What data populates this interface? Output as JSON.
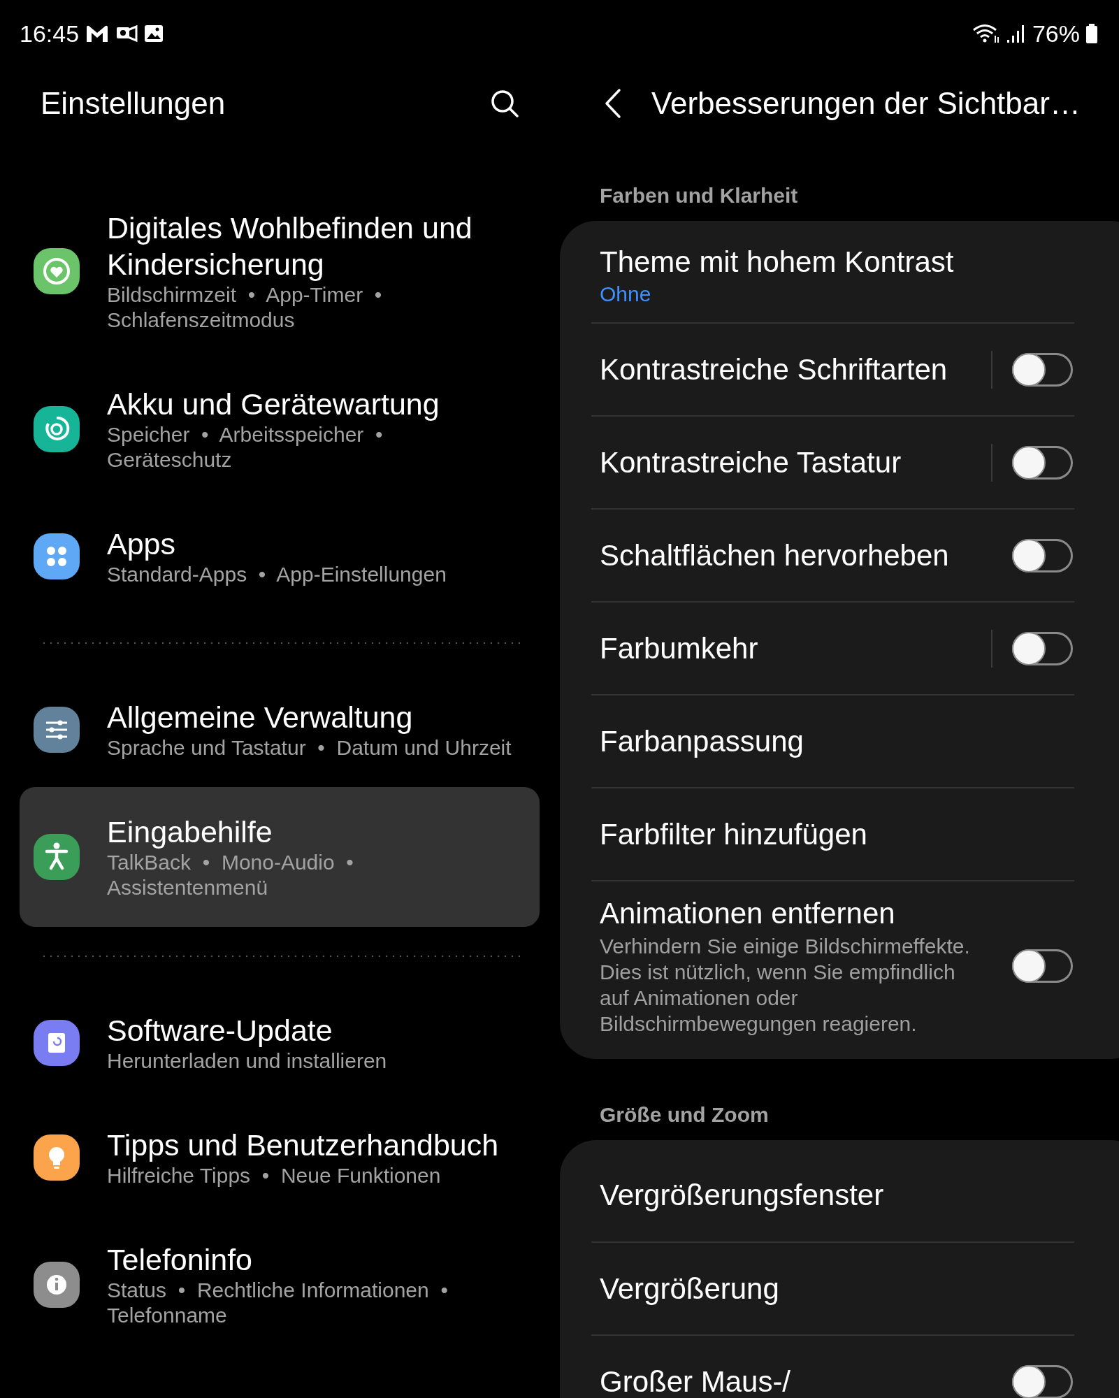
{
  "status_bar": {
    "time": "16:45",
    "battery": "76%"
  },
  "left": {
    "title": "Einstellungen",
    "groups": [
      {
        "items": [
          {
            "title": "Digitales Wohlbefinden und Kindersicherung",
            "subtitle": "Bildschirmzeit  •  App-Timer  •  Schlafenszeitmodus",
            "color": "#6cc46a",
            "selected": false
          },
          {
            "title": "Akku und Gerätewartung",
            "subtitle": "Speicher  •  Arbeitsspeicher  •  Geräteschutz",
            "color": "#17b597",
            "selected": false
          },
          {
            "title": "Apps",
            "subtitle": "Standard-Apps  •  App-Einstellungen",
            "color": "#5ea8f6",
            "selected": false
          }
        ]
      },
      {
        "items": [
          {
            "title": "Allgemeine Verwaltung",
            "subtitle": "Sprache und Tastatur  •  Datum und Uhrzeit",
            "color": "#62829c",
            "selected": false
          },
          {
            "title": "Eingabehilfe",
            "subtitle": "TalkBack  •  Mono-Audio  •  Assistentenmenü",
            "color": "#3a9d58",
            "selected": true
          }
        ]
      },
      {
        "items": [
          {
            "title": "Software-Update",
            "subtitle": "Herunterladen und installieren",
            "color": "#7a7cf2",
            "selected": false
          },
          {
            "title": "Tipps und Benutzerhandbuch",
            "subtitle": "Hilfreiche Tipps  •  Neue Funktionen",
            "color": "#fba44c",
            "selected": false
          },
          {
            "title": "Telefoninfo",
            "subtitle": "Status  •  Rechtliche Informationen  •  Telefonname",
            "color": "#8d8d8d",
            "selected": false
          }
        ]
      }
    ]
  },
  "right": {
    "title": "Verbesserungen der Sichtbar…",
    "sections": [
      {
        "label": "Farben und Klarheit",
        "rows": [
          {
            "kind": "link",
            "title": "Theme mit hohem Kontrast",
            "value": "Ohne"
          },
          {
            "kind": "switch",
            "title": "Kontrastreiche Schriftarten",
            "on": false,
            "split": true
          },
          {
            "kind": "switch",
            "title": "Kontrastreiche Tastatur",
            "on": false,
            "split": true
          },
          {
            "kind": "switch",
            "title": "Schaltflächen hervorheben",
            "on": false,
            "split": false
          },
          {
            "kind": "switch",
            "title": "Farbumkehr",
            "on": false,
            "split": true
          },
          {
            "kind": "link",
            "title": "Farbanpassung"
          },
          {
            "kind": "link",
            "title": "Farbfilter hinzufügen"
          },
          {
            "kind": "switch",
            "title": "Animationen entfernen",
            "description": "Verhindern Sie einige Bildschirmeffekte. Dies ist nützlich, wenn Sie empfindlich auf Animationen oder Bildschirmbewegungen reagieren.",
            "on": false,
            "split": false
          }
        ]
      },
      {
        "label": "Größe und Zoom",
        "rows": [
          {
            "kind": "link",
            "title": "Vergrößerungsfenster"
          },
          {
            "kind": "link",
            "title": "Vergrößerung"
          },
          {
            "kind": "switch",
            "title": "Großer Maus-/",
            "on": false,
            "split": false
          }
        ]
      }
    ]
  }
}
